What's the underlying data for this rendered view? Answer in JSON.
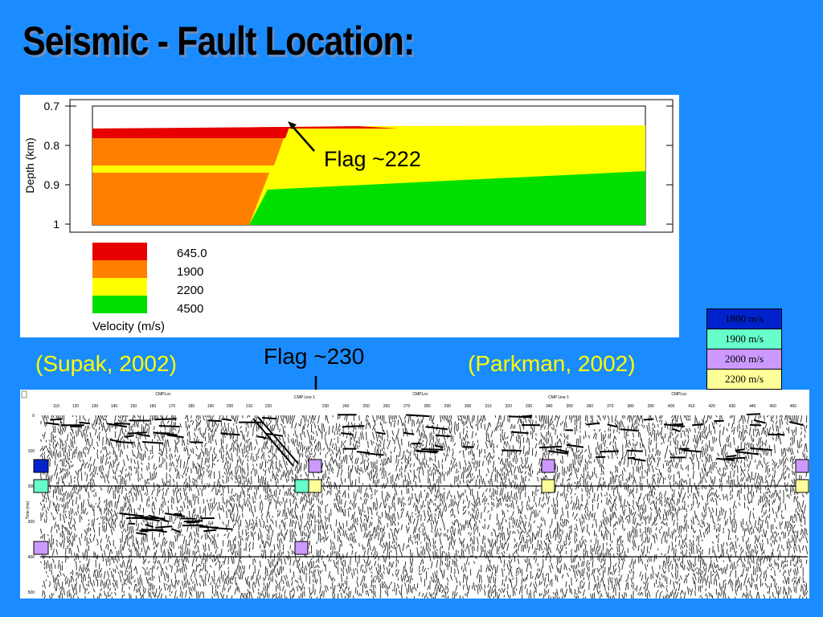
{
  "slide": {
    "title": "Seismic - Fault Location:"
  },
  "model": {
    "ylabel": "Depth (km)",
    "yticks": [
      "0.7",
      "0.8",
      "0.9",
      "1"
    ],
    "flag_label": "Flag ~222",
    "legend_title": "Velocity (m/s)",
    "legend": [
      {
        "label": "645.0",
        "color": "#e60000"
      },
      {
        "label": "1900",
        "color": "#ff7f00"
      },
      {
        "label": "2200",
        "color": "#ffff00"
      },
      {
        "label": "4500",
        "color": "#00e000"
      }
    ]
  },
  "citations": {
    "left": "(Supak, 2002)",
    "right": "(Parkman, 2002)"
  },
  "flag_label_bottom": "Flag ~230",
  "velocity_key": [
    {
      "label": "1800 m/s",
      "color": "#0022cc"
    },
    {
      "label": "1900 m/s",
      "color": "#66ffcc"
    },
    {
      "label": "2000 m/s",
      "color": "#cc99ff"
    },
    {
      "label": "2200 m/s",
      "color": "#ffff99"
    }
  ],
  "seismic": {
    "header_left": "CMPLoc",
    "header_line1": "CMP Line 1",
    "header_mid": "CMPLoc",
    "header_line2": "CMP Line 1",
    "header_right": "CMPLoc",
    "time_label": "Time (ms)",
    "x_ticks_left": [
      "110",
      "120",
      "130",
      "140",
      "150",
      "160",
      "170",
      "180",
      "190",
      "200",
      "210",
      "220"
    ],
    "x_ticks_right": [
      "230",
      "240",
      "250",
      "260",
      "270",
      "280",
      "290",
      "300",
      "310",
      "320",
      "330",
      "340",
      "350",
      "360",
      "370",
      "380",
      "390",
      "400",
      "410",
      "420",
      "430",
      "440",
      "450",
      "460"
    ],
    "y_ticks": [
      "0",
      "100",
      "200",
      "300",
      "400",
      "500"
    ]
  }
}
